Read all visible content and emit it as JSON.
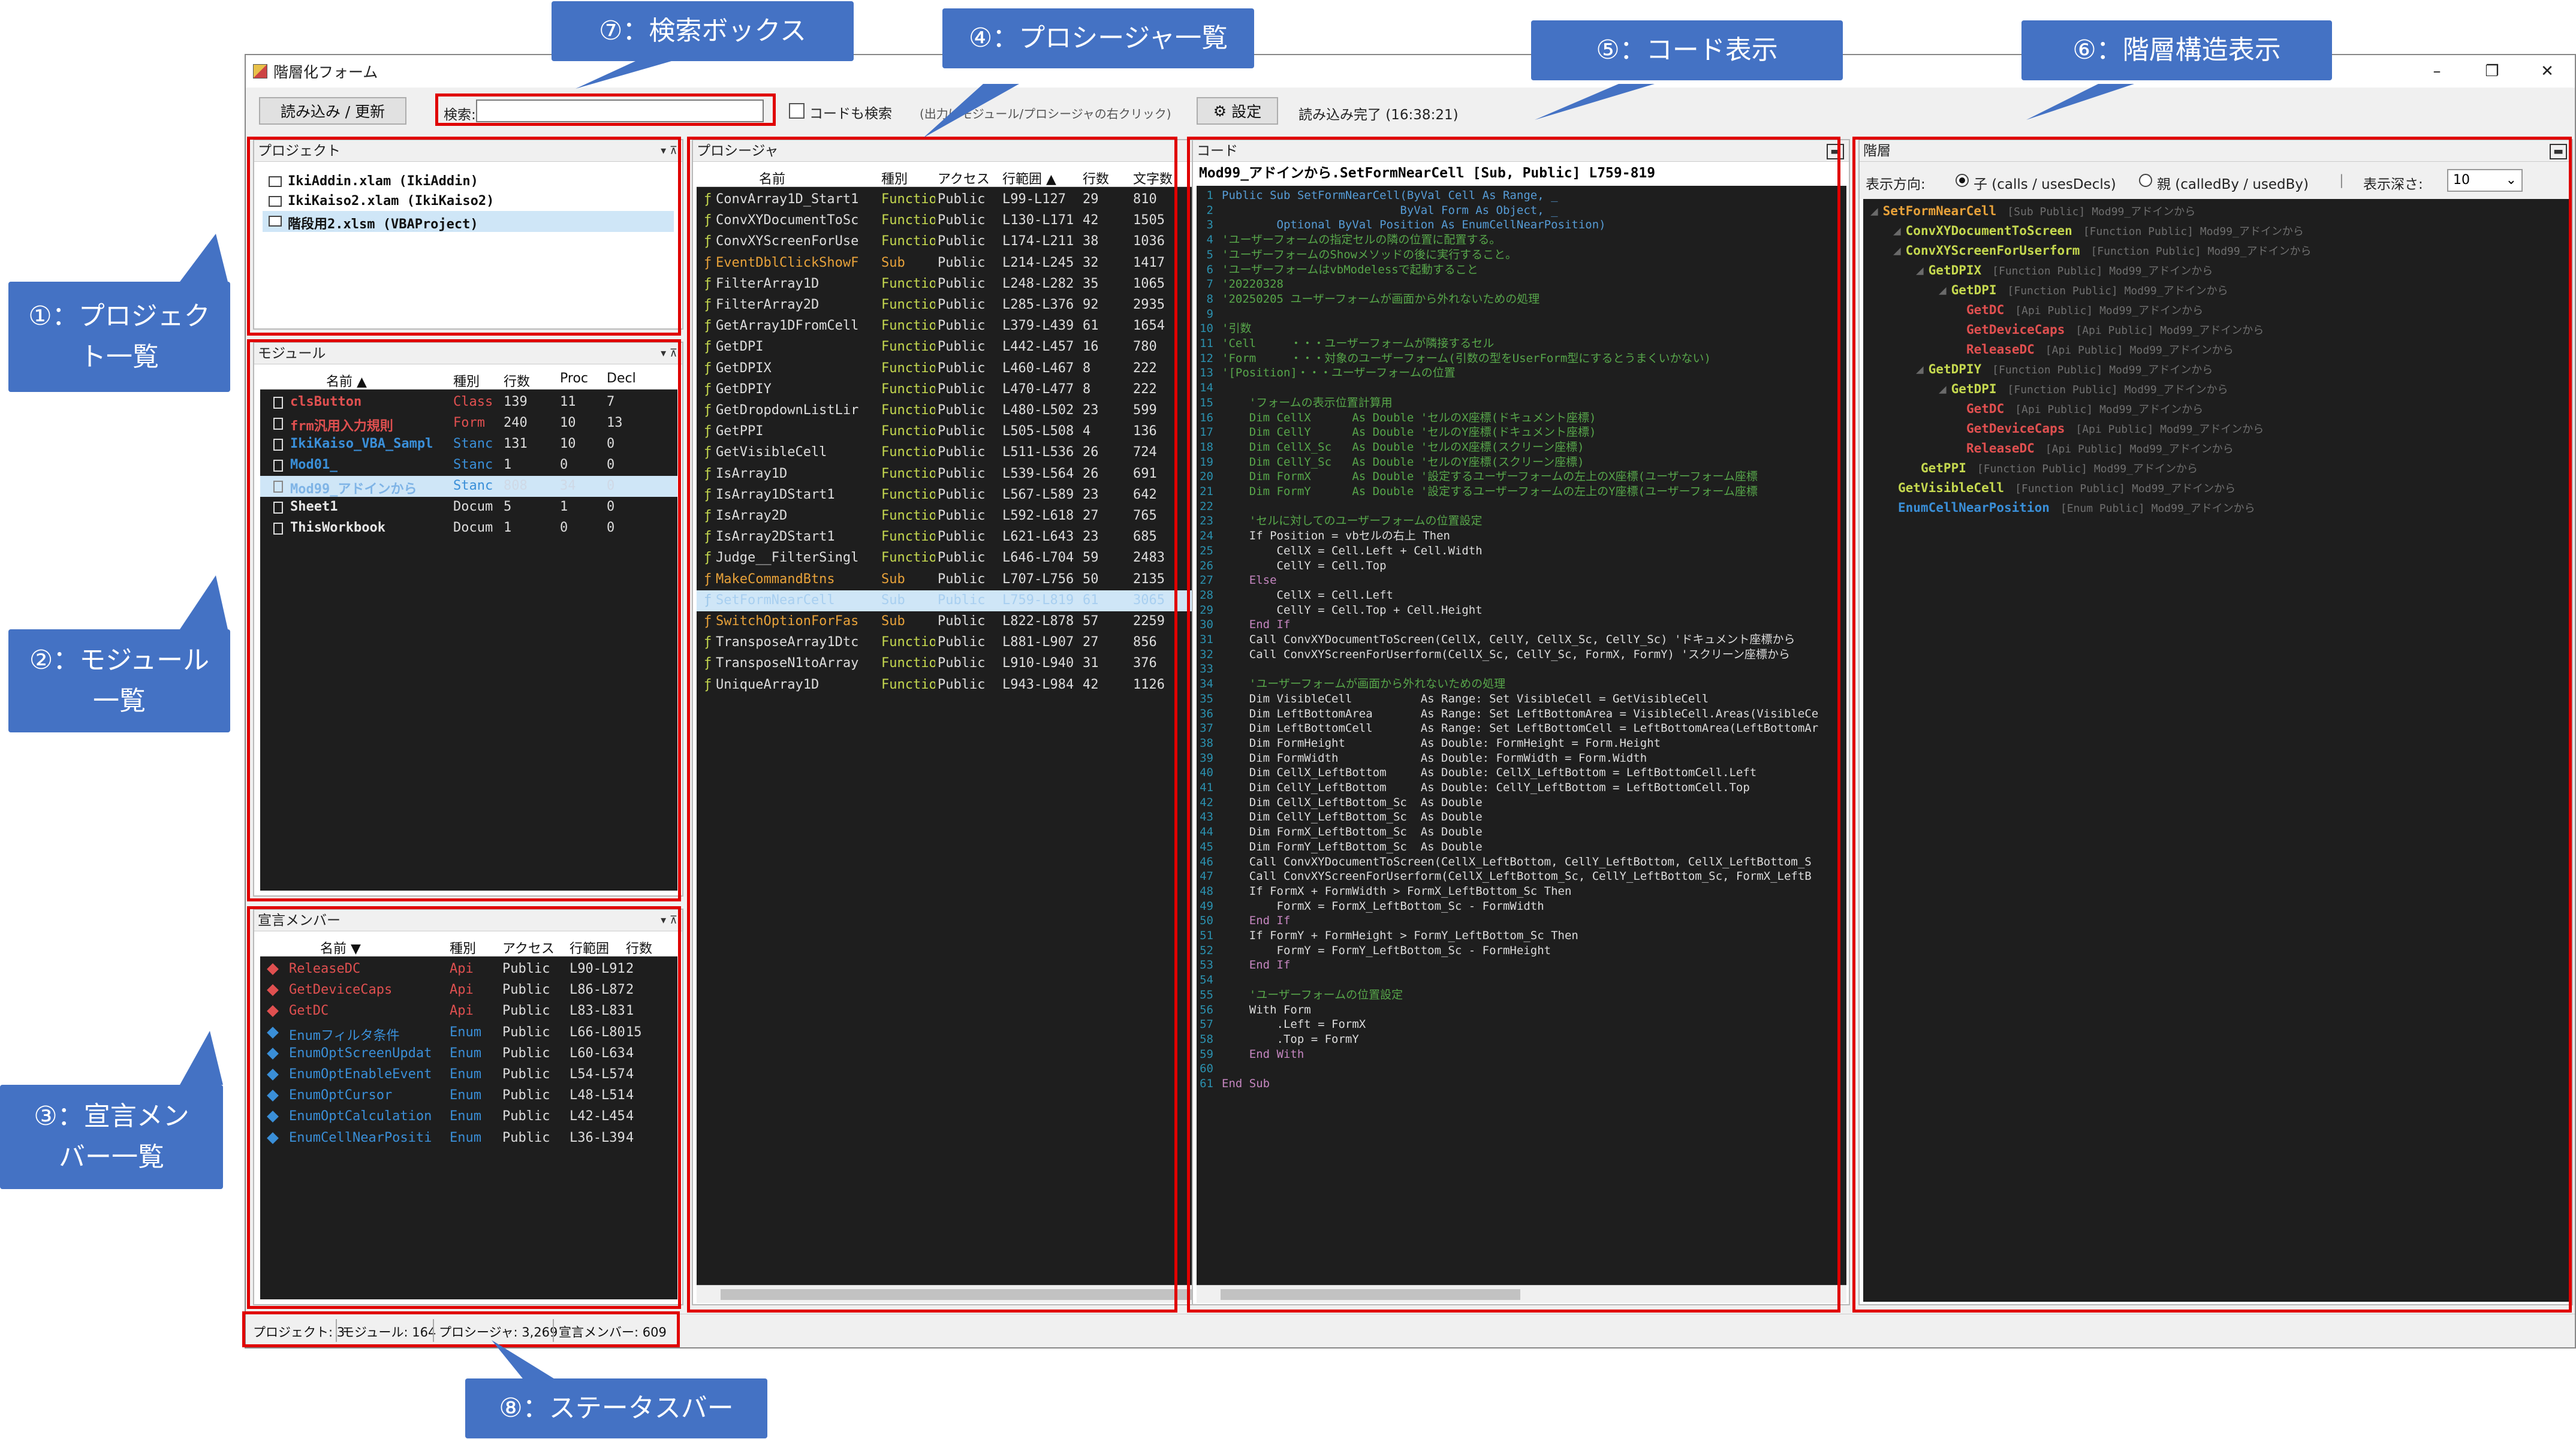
{
  "title": "階層化フォーム",
  "window_buttons": [
    "–",
    "❐",
    "✕"
  ],
  "toolbar": {
    "load_refresh": "読み込み / 更新",
    "search_label": "検索:",
    "search_value": "",
    "code_search": "コードも検索",
    "hint": "(出力はモジュール/プロシージャの右クリック)",
    "settings": "設定",
    "settings_icon": "gear-icon",
    "status": "読み込み完了 (16:38:21)"
  },
  "project_pane": {
    "title": "プロジェクト",
    "items": [
      "IkiAddin.xlam (IkiAddin)",
      "IkiKaiso2.xlam (IkiKaiso2)",
      "階段用2.xlsm (VBAProject)"
    ],
    "selected": 2
  },
  "module_pane": {
    "title": "モジュール",
    "headers": [
      "名前 ▲",
      "種別",
      "行数",
      "Proc",
      "Decl"
    ],
    "rows": [
      [
        "clsButton",
        "Class",
        "139",
        "11",
        "7",
        "#e05050"
      ],
      [
        "frm汎用入力規則",
        "Form",
        "240",
        "10",
        "13",
        "#e05050"
      ],
      [
        "IkiKaiso_VBA_Sampl",
        "Stanc",
        "131",
        "10",
        "0",
        "#3a8fd8"
      ],
      [
        "Mod01_",
        "Stanc",
        "1",
        "0",
        "0",
        "#3a8fd8"
      ],
      [
        "Mod99_アドインから",
        "Stanc",
        "808",
        "34",
        "0",
        "#3a8fd8"
      ],
      [
        "Sheet1",
        "Docum",
        "5",
        "1",
        "0",
        "#111"
      ],
      [
        "ThisWorkbook",
        "Docum",
        "1",
        "0",
        "0",
        "#111"
      ]
    ],
    "selected": 4
  },
  "decl_pane": {
    "title": "宣言メンバー",
    "headers": [
      "名前 ▼",
      "種別",
      "アクセス",
      "行範囲",
      "行数"
    ],
    "rows": [
      [
        "ReleaseDC",
        "Api",
        "Public",
        "L90-L91",
        "2",
        "#e05050"
      ],
      [
        "GetDeviceCaps",
        "Api",
        "Public",
        "L86-L87",
        "2",
        "#e05050"
      ],
      [
        "GetDC",
        "Api",
        "Public",
        "L83-L83",
        "1",
        "#e05050"
      ],
      [
        "Enumフィルタ条件",
        "Enum",
        "Public",
        "L66-L80",
        "15",
        "#3a8fd8"
      ],
      [
        "EnumOptScreenUpdat",
        "Enum",
        "Public",
        "L60-L63",
        "4",
        "#3a8fd8"
      ],
      [
        "EnumOptEnableEvent",
        "Enum",
        "Public",
        "L54-L57",
        "4",
        "#3a8fd8"
      ],
      [
        "EnumOptCursor",
        "Enum",
        "Public",
        "L48-L51",
        "4",
        "#3a8fd8"
      ],
      [
        "EnumOptCalculation",
        "Enum",
        "Public",
        "L42-L45",
        "4",
        "#3a8fd8"
      ],
      [
        "EnumCellNearPositi",
        "Enum",
        "Public",
        "L36-L39",
        "4",
        "#3a8fd8"
      ]
    ]
  },
  "proc_pane": {
    "title": "プロシージャ",
    "headers": [
      "名前",
      "種別",
      "アクセス",
      "行範囲 ▲",
      "行数",
      "文字数"
    ],
    "rows": [
      [
        "ConvArray1D_Start1",
        "Function",
        "Public",
        "L99-L127",
        "29",
        "810"
      ],
      [
        "ConvXYDocumentToSc",
        "Function",
        "Public",
        "L130-L171",
        "42",
        "1505"
      ],
      [
        "ConvXYScreenForUse",
        "Function",
        "Public",
        "L174-L211",
        "38",
        "1036"
      ],
      [
        "EventDblClickShowF",
        "Sub",
        "Public",
        "L214-L245",
        "32",
        "1417"
      ],
      [
        "FilterArray1D",
        "Function",
        "Public",
        "L248-L282",
        "35",
        "1065"
      ],
      [
        "FilterArray2D",
        "Function",
        "Public",
        "L285-L376",
        "92",
        "2935"
      ],
      [
        "GetArray1DFromCell",
        "Function",
        "Public",
        "L379-L439",
        "61",
        "1654"
      ],
      [
        "GetDPI",
        "Function",
        "Public",
        "L442-L457",
        "16",
        "780"
      ],
      [
        "GetDPIX",
        "Function",
        "Public",
        "L460-L467",
        "8",
        "222"
      ],
      [
        "GetDPIY",
        "Function",
        "Public",
        "L470-L477",
        "8",
        "222"
      ],
      [
        "GetDropdownListLir",
        "Function",
        "Public",
        "L480-L502",
        "23",
        "599"
      ],
      [
        "GetPPI",
        "Function",
        "Public",
        "L505-L508",
        "4",
        "136"
      ],
      [
        "GetVisibleCell",
        "Function",
        "Public",
        "L511-L536",
        "26",
        "724"
      ],
      [
        "IsArray1D",
        "Function",
        "Public",
        "L539-L564",
        "26",
        "691"
      ],
      [
        "IsArray1DStart1",
        "Function",
        "Public",
        "L567-L589",
        "23",
        "642"
      ],
      [
        "IsArray2D",
        "Function",
        "Public",
        "L592-L618",
        "27",
        "765"
      ],
      [
        "IsArray2DStart1",
        "Function",
        "Public",
        "L621-L643",
        "23",
        "685"
      ],
      [
        "Judge__FilterSingl",
        "Function",
        "Public",
        "L646-L704",
        "59",
        "2483"
      ],
      [
        "MakeCommandBtns",
        "Sub",
        "Public",
        "L707-L756",
        "50",
        "2135"
      ],
      [
        "SetFormNearCell",
        "Sub",
        "Public",
        "L759-L819",
        "61",
        "3065"
      ],
      [
        "SwitchOptionForFas",
        "Sub",
        "Public",
        "L822-L878",
        "57",
        "2259"
      ],
      [
        "TransposeArray1Dtc",
        "Function",
        "Public",
        "L881-L907",
        "27",
        "856"
      ],
      [
        "TransposeN1toArray",
        "Function",
        "Public",
        "L910-L940",
        "31",
        "376"
      ],
      [
        "UniqueArray1D",
        "Function",
        "Public",
        "L943-L984",
        "42",
        "1126"
      ]
    ],
    "selected": 19
  },
  "code_pane": {
    "title": "コード",
    "header": "Mod99_アドインから.SetFormNearCell [Sub, Public] L759-819",
    "lines": [
      [
        "Public Sub SetFormNearCell(ByVal Cell As Range, _",
        "#569cd6"
      ],
      [
        "                          ByVal Form As Object, _",
        "#569cd6"
      ],
      [
        "        Optional ByVal Position As EnumCellNearPosition)",
        "#569cd6"
      ],
      [
        "'ユーザーフォームの指定セルの隣の位置に配置する。",
        "#57a64a"
      ],
      [
        "'ユーザーフォームのShowメソッドの後に実行すること。",
        "#57a64a"
      ],
      [
        "'ユーザーフォームはvbModelessで起動すること",
        "#57a64a"
      ],
      [
        "'20220328",
        "#57a64a"
      ],
      [
        "'20250205 ユーザーフォームが画面から外れないための処理",
        "#57a64a"
      ],
      [
        "",
        "#dcdcdc"
      ],
      [
        "'引数",
        "#57a64a"
      ],
      [
        "'Cell     ・・・ユーザーフォームが隣接するセル",
        "#57a64a"
      ],
      [
        "'Form     ・・・対象のユーザーフォーム(引数の型をUserForm型にするとうまくいかない)",
        "#57a64a"
      ],
      [
        "'[Position]・・・ユーザーフォームの位置",
        "#57a64a"
      ],
      [
        "",
        "#dcdcdc"
      ],
      [
        "    'フォームの表示位置計算用",
        "#57a64a"
      ],
      [
        "    Dim CellX      As Double 'セルのX座標(ドキュメント座標)",
        "#57a64a"
      ],
      [
        "    Dim CellY      As Double 'セルのY座標(ドキュメント座標)",
        "#57a64a"
      ],
      [
        "    Dim CellX_Sc   As Double 'セルのX座標(スクリーン座標)",
        "#57a64a"
      ],
      [
        "    Dim CellY_Sc   As Double 'セルのY座標(スクリーン座標)",
        "#57a64a"
      ],
      [
        "    Dim FormX      As Double '設定するユーザーフォームの左上のX座標(ユーザーフォーム座標",
        "#57a64a"
      ],
      [
        "    Dim FormY      As Double '設定するユーザーフォームの左上のY座標(ユーザーフォーム座標",
        "#57a64a"
      ],
      [
        "",
        "#dcdcdc"
      ],
      [
        "    'セルに対してのユーザーフォームの位置設定",
        "#57a64a"
      ],
      [
        "    If Position = vbセルの右上 Then",
        "#dcdcdc"
      ],
      [
        "        CellX = Cell.Left + Cell.Width",
        "#dcdcdc"
      ],
      [
        "        CellY = Cell.Top",
        "#dcdcdc"
      ],
      [
        "    Else",
        "#c586c0"
      ],
      [
        "        CellX = Cell.Left",
        "#dcdcdc"
      ],
      [
        "        CellY = Cell.Top + Cell.Height",
        "#dcdcdc"
      ],
      [
        "    End If",
        "#c586c0"
      ],
      [
        "    Call ConvXYDocumentToScreen(CellX, CellY, CellX_Sc, CellY_Sc) 'ドキュメント座標から",
        "#dcdcdc"
      ],
      [
        "    Call ConvXYScreenForUserform(CellX_Sc, CellY_Sc, FormX, FormY) 'スクリーン座標から",
        "#dcdcdc"
      ],
      [
        "",
        "#dcdcdc"
      ],
      [
        "    'ユーザーフォームが画面から外れないための処理",
        "#57a64a"
      ],
      [
        "    Dim VisibleCell          As Range: Set VisibleCell = GetVisibleCell",
        "#dcdcdc"
      ],
      [
        "    Dim LeftBottomArea       As Range: Set LeftBottomArea = VisibleCell.Areas(VisibleCe",
        "#dcdcdc"
      ],
      [
        "    Dim LeftBottomCell       As Range: Set LeftBottomCell = LeftBottomArea(LeftBottomAr",
        "#dcdcdc"
      ],
      [
        "    Dim FormHeight           As Double: FormHeight = Form.Height",
        "#dcdcdc"
      ],
      [
        "    Dim FormWidth            As Double: FormWidth = Form.Width",
        "#dcdcdc"
      ],
      [
        "    Dim CellX_LeftBottom     As Double: CellX_LeftBottom = LeftBottomCell.Left",
        "#dcdcdc"
      ],
      [
        "    Dim CellY_LeftBottom     As Double: CellY_LeftBottom = LeftBottomCell.Top",
        "#dcdcdc"
      ],
      [
        "    Dim CellX_LeftBottom_Sc  As Double",
        "#dcdcdc"
      ],
      [
        "    Dim CellY_LeftBottom_Sc  As Double",
        "#dcdcdc"
      ],
      [
        "    Dim FormX_LeftBottom_Sc  As Double",
        "#dcdcdc"
      ],
      [
        "    Dim FormY_LeftBottom_Sc  As Double",
        "#dcdcdc"
      ],
      [
        "    Call ConvXYDocumentToScreen(CellX_LeftBottom, CellY_LeftBottom, CellX_LeftBottom_S",
        "#dcdcdc"
      ],
      [
        "    Call ConvXYScreenForUserform(CellX_LeftBottom_Sc, CellY_LeftBottom_Sc, FormX_LeftB",
        "#dcdcdc"
      ],
      [
        "    If FormX + FormWidth > FormX_LeftBottom_Sc Then",
        "#dcdcdc"
      ],
      [
        "        FormX = FormX_LeftBottom_Sc - FormWidth",
        "#dcdcdc"
      ],
      [
        "    End If",
        "#c586c0"
      ],
      [
        "    If FormY + FormHeight > FormY_LeftBottom_Sc Then",
        "#dcdcdc"
      ],
      [
        "        FormY = FormY_LeftBottom_Sc - FormHeight",
        "#dcdcdc"
      ],
      [
        "    End If",
        "#c586c0"
      ],
      [
        "",
        "#dcdcdc"
      ],
      [
        "    'ユーザーフォームの位置設定",
        "#57a64a"
      ],
      [
        "    With Form",
        "#dcdcdc"
      ],
      [
        "        .Left = FormX",
        "#dcdcdc"
      ],
      [
        "        .Top = FormY",
        "#dcdcdc"
      ],
      [
        "    End With",
        "#c586c0"
      ],
      [
        "",
        "#dcdcdc"
      ],
      [
        "End Sub",
        "#c586c0"
      ]
    ]
  },
  "tree_pane": {
    "title": "階層",
    "direction_label": "表示方向:",
    "opt_child": "子 (calls / usesDecls)",
    "opt_parent": "親 (calledBy / usedBy)",
    "depth_label": "表示深さ:",
    "depth_value": "10",
    "nodes": [
      [
        "SetFormNearCell",
        "[Sub Public]  Mod99_アドインから",
        "#e8a23a",
        0
      ],
      [
        "ConvXYDocumentToScreen",
        "[Function Public]  Mod99_アドインから",
        "#c5d84f",
        1
      ],
      [
        "ConvXYScreenForUserform",
        "[Function Public]  Mod99_アドインから",
        "#c5d84f",
        1
      ],
      [
        "GetDPIX",
        "[Function Public]  Mod99_アドインから",
        "#c5d84f",
        2
      ],
      [
        "GetDPI",
        "[Function Public]  Mod99_アドインから",
        "#c5d84f",
        3
      ],
      [
        "GetDC",
        "[Api Public]  Mod99_アドインから",
        "#e05050",
        4
      ],
      [
        "GetDeviceCaps",
        "[Api Public]  Mod99_アドインから",
        "#e05050",
        4
      ],
      [
        "ReleaseDC",
        "[Api Public]  Mod99_アドインから",
        "#e05050",
        4
      ],
      [
        "GetDPIY",
        "[Function Public]  Mod99_アドインから",
        "#c5d84f",
        2
      ],
      [
        "GetDPI",
        "[Function Public]  Mod99_アドインから",
        "#c5d84f",
        3
      ],
      [
        "GetDC",
        "[Api Public]  Mod99_アドインから",
        "#e05050",
        4
      ],
      [
        "GetDeviceCaps",
        "[Api Public]  Mod99_アドインから",
        "#e05050",
        4
      ],
      [
        "ReleaseDC",
        "[Api Public]  Mod99_アドインから",
        "#e05050",
        4
      ],
      [
        "GetPPI",
        "[Function Public]  Mod99_アドインから",
        "#c5d84f",
        2
      ],
      [
        "GetVisibleCell",
        "[Function Public]  Mod99_アドインから",
        "#c5d84f",
        1
      ],
      [
        "EnumCellNearPosition",
        "[Enum Public]  Mod99_アドインから",
        "#3a8fd8",
        1
      ]
    ]
  },
  "status": {
    "projects": "プロジェクト: 3",
    "modules": "モジュール: 164",
    "procs": "プロシージャ: 3,269",
    "decls": "宣言メンバー: 609"
  },
  "callouts": {
    "c1": "①：プロジェク\nト一覧",
    "c2": "②：モジュール\n一覧",
    "c3": "③：宣言メン\nバー一覧",
    "c4": "④：プロシージャ一覧",
    "c5": "⑤：コード表示",
    "c6": "⑥：階層構造表示",
    "c7": "⑦：検索ボックス",
    "c8": "⑧：ステータスバー"
  },
  "colors": {
    "callout": "#4472c4",
    "highlight": "#e00000"
  }
}
